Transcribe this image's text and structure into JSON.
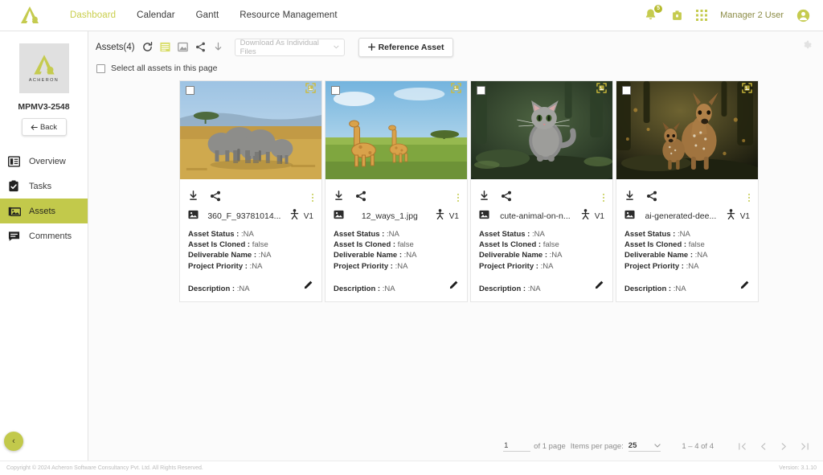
{
  "header": {
    "logo_icon": "acheron-logo-icon",
    "nav": [
      {
        "label": "Dashboard",
        "active": true
      },
      {
        "label": "Calendar",
        "active": false
      },
      {
        "label": "Gantt",
        "active": false
      },
      {
        "label": "Resource Management",
        "active": false
      }
    ],
    "notification_count": "5",
    "user_name": "Manager 2 User"
  },
  "sidebar": {
    "project_logo_text": "ACHERON",
    "project_code": "MPMV3-2548",
    "back_label": "Back",
    "items": [
      {
        "label": "Overview",
        "icon": "overview-icon",
        "active": false
      },
      {
        "label": "Tasks",
        "icon": "tasks-icon",
        "active": false
      },
      {
        "label": "Assets",
        "icon": "assets-icon",
        "active": true
      },
      {
        "label": "Comments",
        "icon": "comments-icon",
        "active": false
      }
    ],
    "collapse_label": "‹"
  },
  "toolbar": {
    "assets_count_label": "Assets(4)",
    "download_placeholder": "Download As Individual Files",
    "reference_asset_label": "Reference Asset",
    "select_all_label": "Select all assets in this page",
    "icons": [
      "refresh-icon",
      "list-view-icon",
      "compare-image-icon",
      "share-icon",
      "download-icon"
    ],
    "settings_icon": "gear-icon"
  },
  "cards": [
    {
      "filename": "360_F_93781014...",
      "version": "V1",
      "image": "elephants-savanna-photo",
      "fields": [
        {
          "label": "Asset Status :",
          "value": ":NA"
        },
        {
          "label": "Asset Is Cloned :",
          "value": "false"
        },
        {
          "label": "Deliverable Name :",
          "value": ":NA"
        },
        {
          "label": "Project Priority :",
          "value": ":NA"
        }
      ],
      "description_label": "Description :",
      "description_value": ":NA"
    },
    {
      "filename": "12_ways_1.jpg",
      "version": "V1",
      "image": "giraffes-grassland-photo",
      "fields": [
        {
          "label": "Asset Status :",
          "value": ":NA"
        },
        {
          "label": "Asset Is Cloned :",
          "value": "false"
        },
        {
          "label": "Deliverable Name :",
          "value": ":NA"
        },
        {
          "label": "Project Priority :",
          "value": ":NA"
        }
      ],
      "description_label": "Description :",
      "description_value": ":NA"
    },
    {
      "filename": "cute-animal-on-n...",
      "version": "V1",
      "image": "kitten-forest-photo",
      "fields": [
        {
          "label": "Asset Status :",
          "value": ":NA"
        },
        {
          "label": "Asset Is Cloned :",
          "value": "false"
        },
        {
          "label": "Deliverable Name :",
          "value": ":NA"
        },
        {
          "label": "Project Priority :",
          "value": ":NA"
        }
      ],
      "description_label": "Description :",
      "description_value": ":NA"
    },
    {
      "filename": "ai-generated-dee...",
      "version": "V1",
      "image": "deer-fawn-forest-photo",
      "fields": [
        {
          "label": "Asset Status :",
          "value": ":NA"
        },
        {
          "label": "Asset Is Cloned :",
          "value": "false"
        },
        {
          "label": "Deliverable Name :",
          "value": ":NA"
        },
        {
          "label": "Project Priority :",
          "value": ":NA"
        }
      ],
      "description_label": "Description :",
      "description_value": ":NA"
    }
  ],
  "paginator": {
    "page_value": "1",
    "of_pages_label": "of 1 page",
    "items_per_page_label": "Items per page:",
    "items_per_page_value": "25",
    "range_label": "1 – 4 of 4",
    "first_icon": "first-page-icon",
    "prev_icon": "prev-page-icon",
    "next_icon": "next-page-icon",
    "last_icon": "last-page-icon"
  },
  "footer": {
    "copyright": "Copyright © 2024 Acheron Software Consultancy Pvt. Ltd. All Rights Reserved.",
    "version": "Version: 3.1.10"
  },
  "colors": {
    "accent": "#c2c94b",
    "accent_dark": "#b6bb2e",
    "nav_active": "#c9ce4b"
  }
}
